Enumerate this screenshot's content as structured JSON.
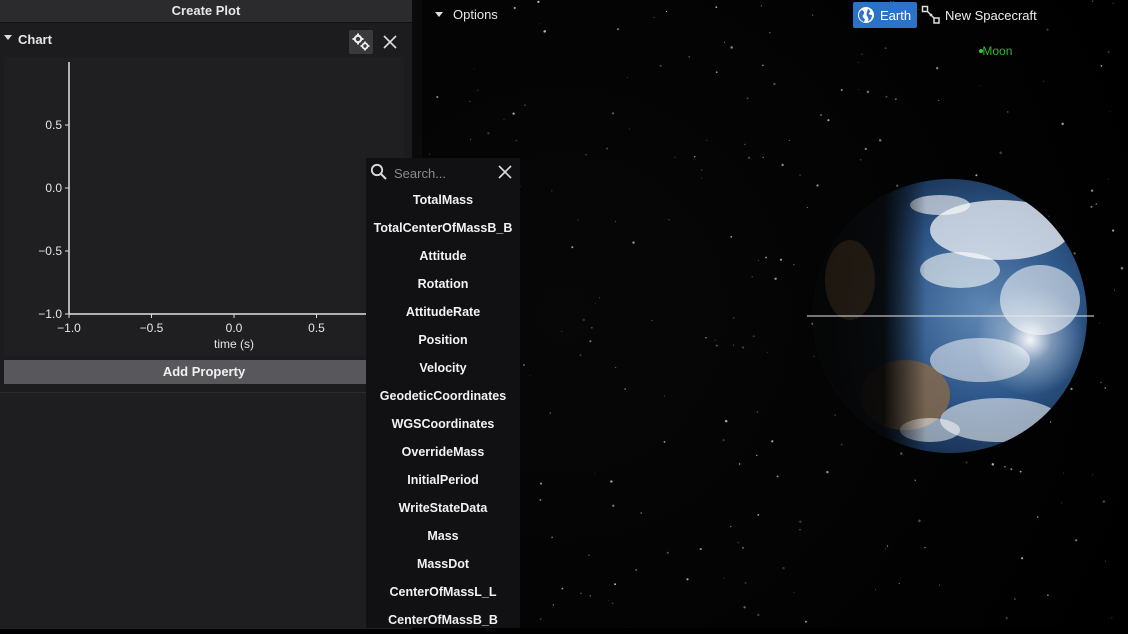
{
  "left_panel": {
    "create_plot_label": "Create Plot",
    "chart_title": "Chart",
    "add_property_label": "Add Property"
  },
  "chart_data": {
    "type": "line",
    "xlabel": "time (s)",
    "ylabel": "",
    "xlim": [
      -1.0,
      1.0
    ],
    "ylim": [
      -1.0,
      1.0
    ],
    "x_ticks": [
      "−1.0",
      "−0.5",
      "0.0",
      "0.5"
    ],
    "y_ticks": [
      "0.5",
      "0.0",
      "−0.5",
      "−1.0"
    ],
    "series": [],
    "grid": false
  },
  "dropdown": {
    "search_placeholder": "Search...",
    "items": [
      "TotalMass",
      "TotalCenterOfMassB_B",
      "Attitude",
      "Rotation",
      "AttitudeRate",
      "Position",
      "Velocity",
      "GeodeticCoordinates",
      "WGSCoordinates",
      "OverrideMass",
      "InitialPeriod",
      "WriteStateData",
      "Mass",
      "MassDot",
      "CenterOfMassL_L",
      "CenterOfMassB_B"
    ]
  },
  "options_label": "Options",
  "objects": {
    "earth_label": "Earth",
    "spacecraft_label": "New Spacecraft",
    "moon_label": "Moon"
  },
  "colors": {
    "accent": "#2b73c7",
    "moon": "#35b53a"
  }
}
